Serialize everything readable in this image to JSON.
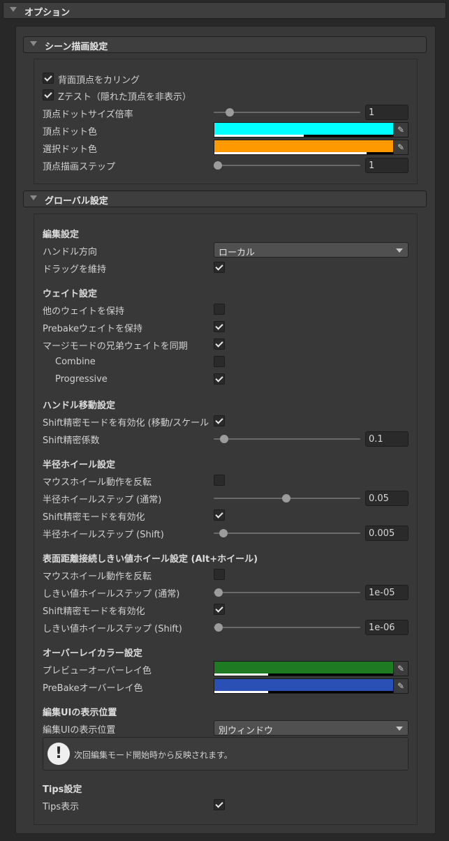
{
  "sections": {
    "options": "オプション",
    "scene": "シーン描画設定",
    "global": "グローバル設定"
  },
  "scene": {
    "backface_culling": {
      "label": "背面頂点をカリング",
      "checked": true
    },
    "ztest": {
      "label": "Zテスト（隠れた頂点を非表示）",
      "checked": true
    },
    "dot_size": {
      "label": "頂点ドットサイズ倍率",
      "value": "1",
      "fraction": 0.1
    },
    "dot_color": {
      "label": "頂点ドット色",
      "color": "#00ffff",
      "alpha": 0.6
    },
    "select_color": {
      "label": "選択ドット色",
      "color": "#ff9900",
      "alpha": 0.85
    },
    "draw_step": {
      "label": "頂点描画ステップ",
      "value": "1",
      "fraction": 0.0
    }
  },
  "global": {
    "edit": {
      "header": "編集設定",
      "handle_dir": {
        "label": "ハンドル方向",
        "value": "ローカル"
      },
      "keep_drag": {
        "label": "ドラッグを維持",
        "checked": true
      }
    },
    "weight": {
      "header": "ウェイト設定",
      "keep_other": {
        "label": "他のウェイトを保持",
        "checked": false
      },
      "keep_prebake": {
        "label": "Prebakeウェイトを保持",
        "checked": true
      },
      "sync_merge": {
        "label": "マージモードの兄弟ウェイトを同期",
        "checked": true
      },
      "combine": {
        "label": "Combine",
        "checked": false
      },
      "progressive": {
        "label": "Progressive",
        "checked": true
      }
    },
    "handle_move": {
      "header": "ハンドル移動設定",
      "shift_precise": {
        "label": "Shift精密モードを有効化 (移動/スケール",
        "checked": true
      },
      "shift_factor": {
        "label": "Shift精密係数",
        "value": "0.1",
        "fraction": 0.07
      }
    },
    "radius_wheel": {
      "header": "半径ホイール設定",
      "invert": {
        "label": "マウスホイール動作を反転",
        "checked": false
      },
      "step_normal": {
        "label": "半径ホイールステップ (通常)",
        "value": "0.05",
        "fraction": 0.5
      },
      "shift_enable": {
        "label": "Shift精密モードを有効化",
        "checked": true
      },
      "step_shift": {
        "label": "半径ホイールステップ (Shift)",
        "value": "0.005",
        "fraction": 0.05
      }
    },
    "surface_wheel": {
      "header": "表面距離接続しきい値ホイール設定 (Alt+ホイール)",
      "invert": {
        "label": "マウスホイール動作を反転",
        "checked": false
      },
      "step_normal": {
        "label": "しきい値ホイールステップ (通常)",
        "value": "1e-05",
        "fraction": 0.0
      },
      "shift_enable": {
        "label": "Shift精密モードを有効化",
        "checked": true
      },
      "step_shift": {
        "label": "しきい値ホイールステップ (Shift)",
        "value": "1e-06",
        "fraction": 0.0
      }
    },
    "overlay": {
      "header": "オーバーレイカラー設定",
      "preview": {
        "label": "プレビューオーバーレイ色",
        "color": "#1f7a24",
        "alpha": 0.3
      },
      "prebake": {
        "label": "PreBakeオーバーレイ色",
        "color": "#2a4fb5",
        "alpha": 0.3
      }
    },
    "ui_pos": {
      "header": "編集UIの表示位置",
      "pos": {
        "label": "編集UIの表示位置",
        "value": "別ウィンドウ"
      },
      "help": "次回編集モード開始時から反映されます。"
    },
    "tips": {
      "header": "Tips設定",
      "show": {
        "label": "Tips表示",
        "checked": true
      }
    }
  },
  "icons": {
    "foldout": "triangle-down-icon",
    "eyedropper": "eyedropper-icon",
    "warning": "exclamation-icon"
  }
}
